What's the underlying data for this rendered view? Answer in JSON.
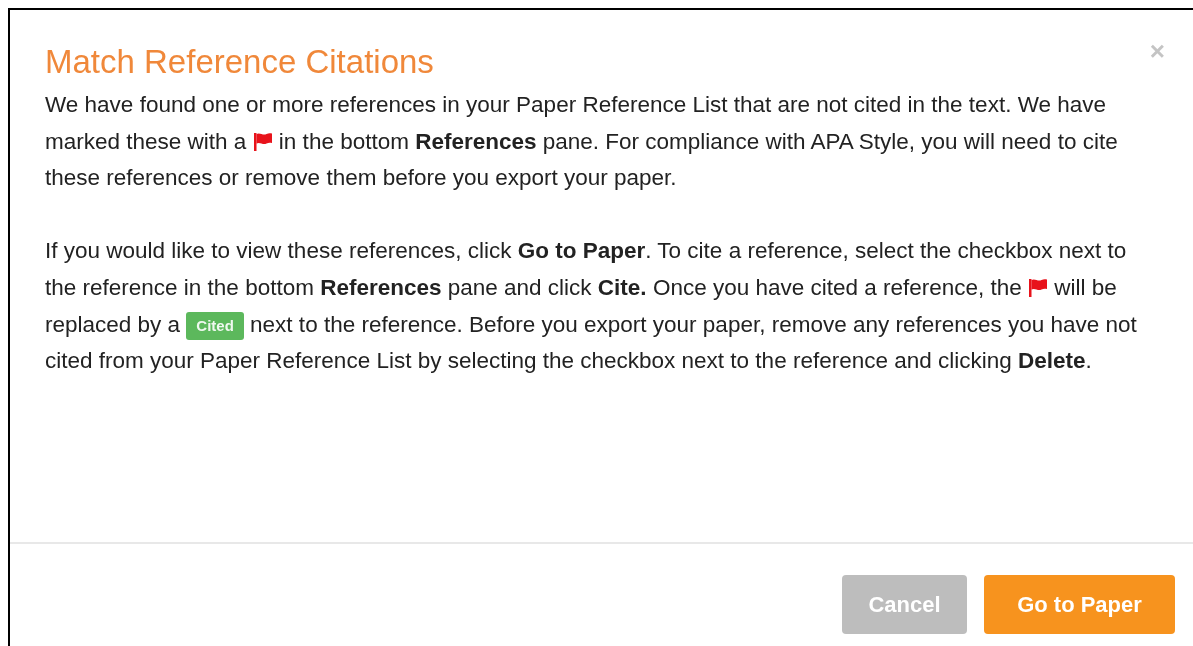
{
  "dialog": {
    "title": "Match Reference Citations",
    "close": "×",
    "paragraphs": [
      [
        {
          "kind": "text",
          "text": "We have found one or more references in your Paper Reference List that are not cited in the text. We have marked these with a "
        },
        {
          "kind": "flag"
        },
        {
          "kind": "text",
          "text": " in the bottom **References** pane. For compliance with APA Style, you will need to cite these references or remove them before you export your paper."
        }
      ],
      [
        {
          "kind": "text",
          "text": "If you would like to view these references, click **Go to Paper**. To cite a reference, select the checkbox next to the reference in the bottom **References** pane and click **Cite.** Once you have cited a reference, the "
        },
        {
          "kind": "flag"
        },
        {
          "kind": "text",
          "text": " will be replaced by a "
        },
        {
          "kind": "badge",
          "text": "Cited"
        },
        {
          "kind": "text",
          "text": " next to the reference. Before you export your paper, remove any references you have not cited from your Paper Reference List by selecting the checkbox next to the reference and clicking **Delete**."
        }
      ]
    ],
    "buttons": [
      {
        "label": "Cancel",
        "kind": "secondary"
      },
      {
        "label": "Go to Paper",
        "kind": "primary"
      }
    ]
  }
}
